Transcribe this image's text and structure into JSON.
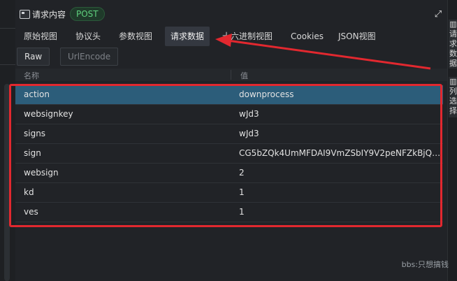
{
  "panel": {
    "title": "请求内容",
    "method": "POST",
    "expand_icon": "expand-icon"
  },
  "tabs": [
    {
      "label": "原始视图"
    },
    {
      "label": "协议头"
    },
    {
      "label": "参数视图"
    },
    {
      "label": "请求数据",
      "active": true
    },
    {
      "label": "十六进制视图"
    },
    {
      "label": "Cookies"
    },
    {
      "label": "JSON视图"
    }
  ],
  "buttons": {
    "raw": "Raw",
    "urlencode": "UrlEncode"
  },
  "table": {
    "headers": {
      "name": "名称",
      "value": "值"
    },
    "rows": [
      {
        "name": "action",
        "value": "downprocess"
      },
      {
        "name": "websignkey",
        "value": "wJd3"
      },
      {
        "name": "signs",
        "value": "wJd3"
      },
      {
        "name": "sign",
        "value": "CG5bZQk4UmMFDAI9VmZSbIY9V2peNFZkBjQDMF..."
      },
      {
        "name": "websign",
        "value": "2"
      },
      {
        "name": "kd",
        "value": "1"
      },
      {
        "name": "ves",
        "value": "1"
      }
    ]
  },
  "side_tabs": [
    {
      "label": "请求数据"
    },
    {
      "label": "列选择"
    }
  ],
  "watermark": "bbs:只想搞钱",
  "colors": {
    "selected_row": "#2c5d7a",
    "annotation_red": "#e2282f",
    "post_badge": "#5fd17e"
  }
}
